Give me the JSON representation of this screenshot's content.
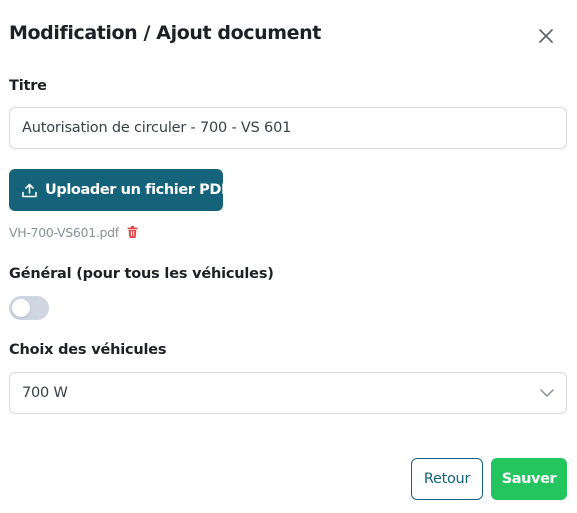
{
  "dialog": {
    "title": "Modification / Ajout document",
    "close_icon": "close-icon"
  },
  "title_field": {
    "label": "Titre",
    "value": "Autorisation de circuler - 700 - VS 601"
  },
  "upload": {
    "label": "Uploader un fichier PDF",
    "icon": "upload-icon",
    "color": "#14637a"
  },
  "file": {
    "name": "VH-700-VS601.pdf",
    "delete_icon": "trash-icon",
    "delete_color": "#e5484d"
  },
  "general": {
    "label": "Général (pour tous les véhicules)",
    "enabled": false
  },
  "vehicles": {
    "label": "Choix des véhicules",
    "selected": "700 W",
    "icon": "chevron-down-icon"
  },
  "actions": {
    "back_label": "Retour",
    "save_label": "Sauver",
    "save_color": "#24c45f"
  }
}
